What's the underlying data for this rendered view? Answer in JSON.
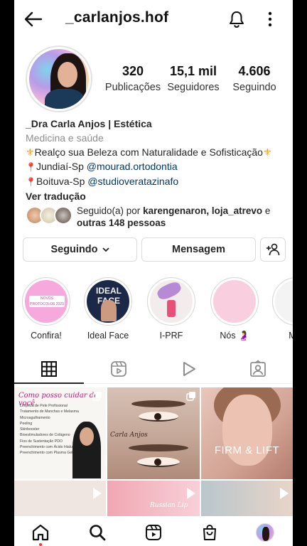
{
  "header": {
    "username": "_carlanjos.hof"
  },
  "stats": [
    {
      "value": "320",
      "label": "Publicações"
    },
    {
      "value": "15,1 mil",
      "label": "Seguidores"
    },
    {
      "value": "4.606",
      "label": "Seguindo"
    }
  ],
  "bio": {
    "name": "_Dra Carla Anjos | Estética",
    "category": "Medicina e saúde",
    "line1": "Realço sua Beleza com Naturalidade e Sofisticação",
    "line2_city": "Jundiaí-Sp",
    "line2_handle": "@mourad.ortodontia",
    "line3_city": "Boituva-Sp",
    "line3_handle": "@studioveratazinafo",
    "translate": "Ver tradução"
  },
  "followed_by": {
    "prefix": "Seguido(a) por",
    "names": "karengenaron, loja_atrevo",
    "connector": "e",
    "others": "outras 148 pessoas"
  },
  "buttons": {
    "following": "Seguindo",
    "message": "Mensagem"
  },
  "highlights": [
    {
      "label": "Confira!",
      "cover_text": "NOVOS PROTOCOLOS 2023"
    },
    {
      "label": "Ideal Face",
      "cover_text": "IDEAL FACE"
    },
    {
      "label": "I-PRF"
    },
    {
      "label": "Nós 🤰"
    },
    {
      "label": "Mar"
    }
  ],
  "grid": {
    "post1_title": "Como posso cuidar de você",
    "post1_items": [
      "Limpeza de Pele Profissional",
      "Tratamento de Manchas e Melasma",
      "Microagulhamento",
      "Peeling",
      "Skinbooster",
      "Bioestimuladores de Colágeno",
      "Fios de Sustentação PDO",
      "Preenchimento com Ácido Hialurônico",
      "Preenchimento com Plasma Gel PRP"
    ],
    "post2_brand": "Carla Anjos",
    "post3_text": "FIRM & LIFT",
    "post5_text": "Russian Lip"
  }
}
